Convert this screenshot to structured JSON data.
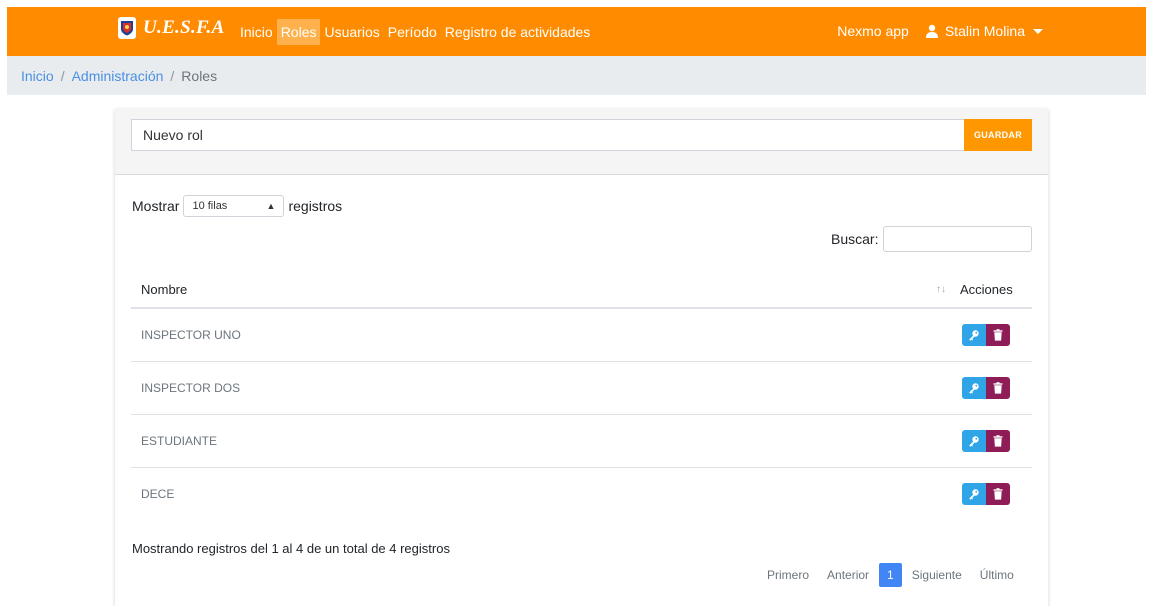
{
  "brand": {
    "name": "U.E.S.F.A",
    "logo": "school-crest-icon"
  },
  "nav": {
    "links": [
      {
        "label": "Inicio",
        "active": false
      },
      {
        "label": "Roles",
        "active": true
      },
      {
        "label": "Usuarios",
        "active": false
      },
      {
        "label": "Período",
        "active": false
      },
      {
        "label": "Registro de actividades",
        "active": false
      }
    ],
    "app_link": "Nexmo app",
    "user_name": "Stalin Molina"
  },
  "breadcrumb": {
    "items": [
      "Inicio",
      "Administración"
    ],
    "separator": "/",
    "current": "Roles"
  },
  "form": {
    "role_value": "Nuevo rol",
    "save_label": "GUARDAR"
  },
  "table_controls": {
    "show_label": "Mostrar",
    "rows_selected": "10 filas",
    "records_label": "registros",
    "search_label": "Buscar:",
    "search_value": ""
  },
  "table": {
    "headers": {
      "name": "Nombre",
      "actions": "Acciones"
    },
    "rows": [
      {
        "name": "INSPECTOR UNO"
      },
      {
        "name": "INSPECTOR DOS"
      },
      {
        "name": "ESTUDIANTE"
      },
      {
        "name": "DECE"
      }
    ]
  },
  "footer": {
    "info": "Mostrando registros del 1 al 4 de un total de 4 registros",
    "pagination": {
      "first": "Primero",
      "prev": "Anterior",
      "current": "1",
      "next": "Siguiente",
      "last": "Último"
    }
  },
  "colors": {
    "navbar": "#ff8c00",
    "save_button": "#ff9800",
    "key_button": "#2fa4e7",
    "delete_button": "#8e1c56",
    "active_page": "#4285f4"
  }
}
